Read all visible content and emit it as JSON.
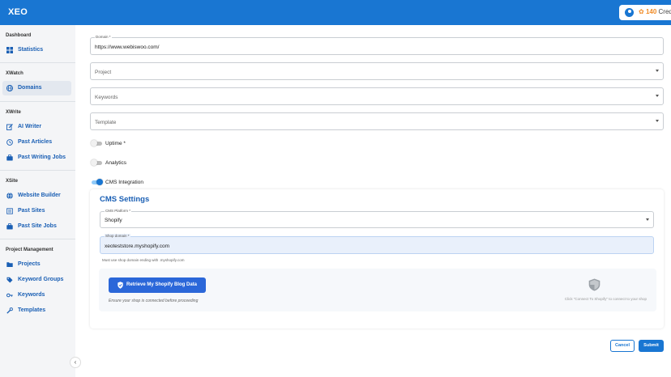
{
  "app": {
    "logo": "XEO"
  },
  "header": {
    "credits_count": "140",
    "credits_label": "Credits"
  },
  "sidebar": {
    "sections": [
      {
        "title": "Dashboard",
        "items": [
          {
            "label": "Statistics",
            "icon": "grid-icon"
          }
        ]
      },
      {
        "title": "XWatch",
        "items": [
          {
            "label": "Domains",
            "icon": "globe-icon",
            "active": true
          }
        ]
      },
      {
        "title": "XWrite",
        "items": [
          {
            "label": "AI Writer",
            "icon": "edit-icon"
          },
          {
            "label": "Past Articles",
            "icon": "history-icon"
          },
          {
            "label": "Past Writing Jobs",
            "icon": "briefcase-icon"
          }
        ]
      },
      {
        "title": "XSite",
        "items": [
          {
            "label": "Website Builder",
            "icon": "globe-icon"
          },
          {
            "label": "Past Sites",
            "icon": "list-icon"
          },
          {
            "label": "Past Site Jobs",
            "icon": "briefcase-icon"
          }
        ]
      },
      {
        "title": "Project Management",
        "items": [
          {
            "label": "Projects",
            "icon": "folder-icon"
          },
          {
            "label": "Keyword Groups",
            "icon": "tags-icon"
          },
          {
            "label": "Keywords",
            "icon": "key-icon"
          },
          {
            "label": "Templates",
            "icon": "tool-icon"
          }
        ]
      }
    ]
  },
  "form": {
    "domain_label": "Domain *",
    "domain_value": "https://www.webiswoo.com/",
    "project_placeholder": "Project",
    "keywords_placeholder": "Keywords",
    "template_placeholder": "Template",
    "uptime_label": "Uptime *",
    "analytics_label": "Analytics",
    "cms_integration_label": "CMS Integration",
    "toggles": {
      "uptime": false,
      "analytics": false,
      "cms_integration": true
    }
  },
  "cms": {
    "title": "CMS Settings",
    "platform_label": "CMS Platform *",
    "platform_value": "Shopify",
    "shop_domain_label": "Shop domain *",
    "shop_domain_value": "xeoteststore.myshopify.com",
    "helper_text": "Must use shop domain ending with .myshopify.com",
    "retrieve_button": "Retrieve My Shopify Blog Data",
    "ensure_text": "Ensure your shop is connected before proceeding",
    "connect_hint": "Click \"Connect To Shopify\" to connect to your shop"
  },
  "actions": {
    "cancel": "Cancel",
    "submit": "Submit"
  },
  "colors": {
    "primary": "#1976d2",
    "nav_text": "#1a5fb4",
    "credits": "#f08a24"
  }
}
